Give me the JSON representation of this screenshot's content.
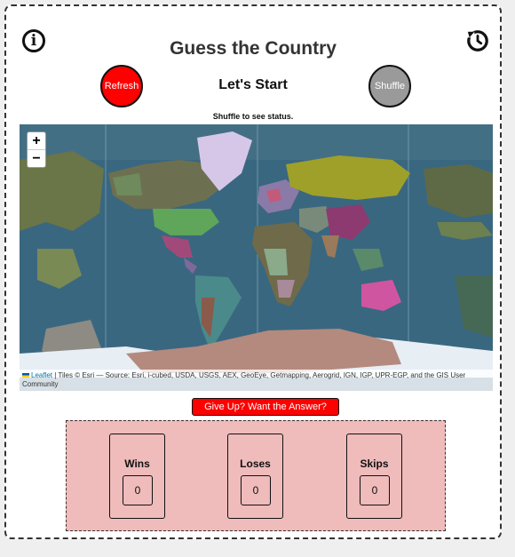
{
  "game": {
    "title": "Guess the Country",
    "question": "Let's Start",
    "status": "Shuffle to see status.",
    "give_up_label": "Give Up? Want the Answer?"
  },
  "controls": {
    "refresh_label": "Refresh",
    "shuffle_label": "Shuffle",
    "info_icon": "info-icon",
    "history_icon": "history-icon"
  },
  "map": {
    "zoom_in": "+",
    "zoom_out": "−",
    "attribution_link": "Leaflet",
    "attribution_text": " | Tiles © Esri — Source: Esri, i-cubed, USDA, USGS, AEX, GeoEye, Getmapping, Aerogrid, IGN, IGP, UPR-EGP, and the GIS User Community"
  },
  "stats": [
    {
      "label": "Wins",
      "value": "0"
    },
    {
      "label": "Loses",
      "value": "0"
    },
    {
      "label": "Skips",
      "value": "0"
    }
  ],
  "colors": {
    "refresh": "#ff0000",
    "shuffle": "#9a9a9a",
    "give_up": "#ff0000",
    "stats_bg": "#efbbbb",
    "ocean": "#3d6a82"
  }
}
